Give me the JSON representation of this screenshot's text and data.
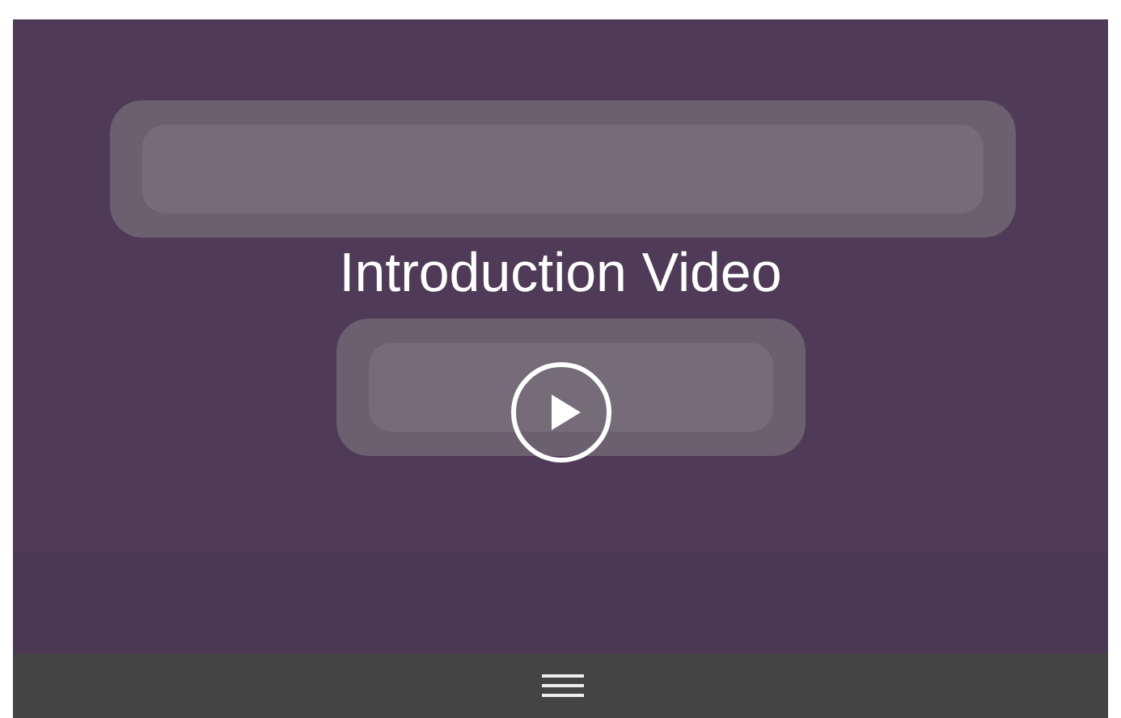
{
  "video": {
    "title": "Introduction Video"
  }
}
